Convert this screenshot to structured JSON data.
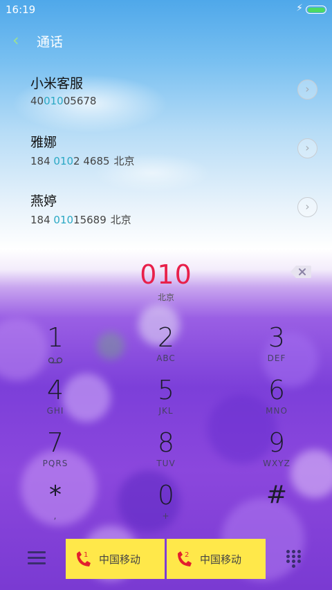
{
  "status_bar": {
    "time": "16:19"
  },
  "header": {
    "title": "通话"
  },
  "contacts": [
    {
      "name": "小米客服",
      "number_pre": "40",
      "number_match": "010",
      "number_post": "05678",
      "location": ""
    },
    {
      "name": "雅娜",
      "number_pre": "184 ",
      "number_match": "010",
      "number_post": "2 4685",
      "location": "北京"
    },
    {
      "name": "燕婷",
      "number_pre": "184 ",
      "number_match": "010",
      "number_post": "15689",
      "location": "北京"
    }
  ],
  "dialer": {
    "input": "010",
    "region": "北京"
  },
  "keys": [
    {
      "num": "1",
      "sub": ""
    },
    {
      "num": "2",
      "sub": "ABC"
    },
    {
      "num": "3",
      "sub": "DEF"
    },
    {
      "num": "4",
      "sub": "GHI"
    },
    {
      "num": "5",
      "sub": "JKL"
    },
    {
      "num": "6",
      "sub": "MNO"
    },
    {
      "num": "7",
      "sub": "PQRS"
    },
    {
      "num": "8",
      "sub": "TUV"
    },
    {
      "num": "9",
      "sub": "WXYZ"
    },
    {
      "num": "*",
      "sub": ","
    },
    {
      "num": "0",
      "sub": "+"
    },
    {
      "num": "#",
      "sub": ""
    }
  ],
  "bottom_bar": {
    "sim1": {
      "label": "中国移动",
      "slot": "1"
    },
    "sim2": {
      "label": "中国移动",
      "slot": "2"
    }
  },
  "colors": {
    "input_digits": "#e8204a",
    "match_highlight": "#2aa8c4",
    "call_button": "#ffe84a",
    "back_arrow": "#9ee28f"
  }
}
